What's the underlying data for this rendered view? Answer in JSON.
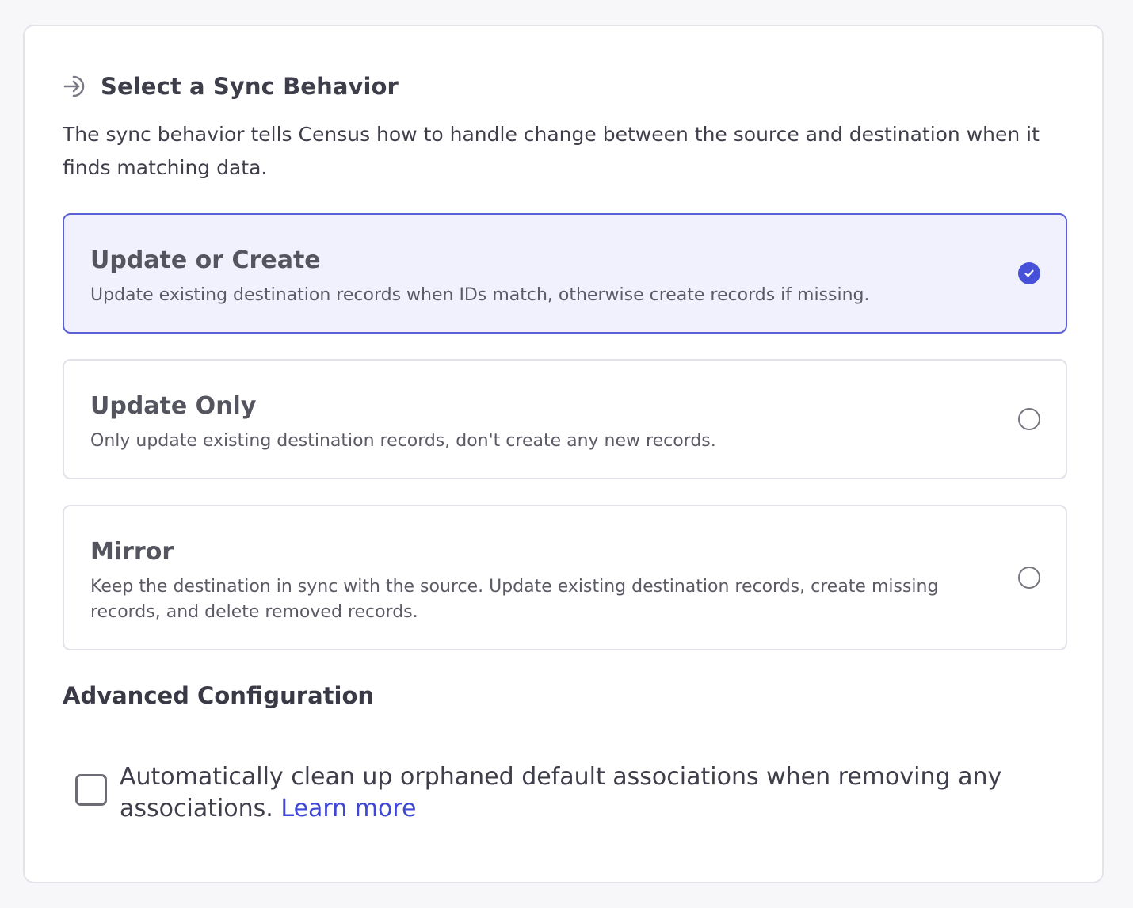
{
  "section": {
    "title": "Select a Sync Behavior",
    "description": "The sync behavior tells Census how to handle change between the source and destination when it finds matching data."
  },
  "options": [
    {
      "title": "Update or Create",
      "description": "Update existing destination records when IDs match, otherwise create records if missing.",
      "selected": true
    },
    {
      "title": "Update Only",
      "description": "Only update existing destination records, don't create any new records.",
      "selected": false
    },
    {
      "title": "Mirror",
      "description": "Keep the destination in sync with the source. Update existing destination records, create missing records, and delete removed records.",
      "selected": false
    }
  ],
  "advanced": {
    "title": "Advanced Configuration",
    "cleanup_label": "Automatically clean up orphaned default associations when removing any associations.",
    "learn_more": "Learn more",
    "cleanup_checked": false
  },
  "colors": {
    "accent": "#4750d8",
    "selected_bg": "#f0f1fd",
    "link": "#3f47d4"
  }
}
